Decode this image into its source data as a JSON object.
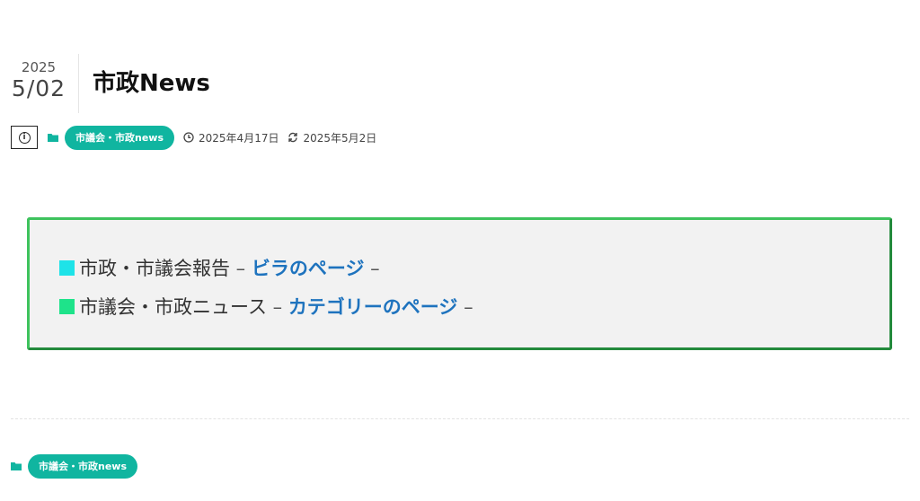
{
  "post": {
    "year": "2025",
    "month_day": "5/02",
    "title": "市政News",
    "category": "市議会・市政news",
    "published": "2025年4月17日",
    "updated": "2025年5月2日"
  },
  "icons": {
    "info": "info-icon",
    "folder": "folder-icon",
    "clock": "clock-icon",
    "refresh": "refresh-icon"
  },
  "notice": {
    "line1_prefix": "市政・市議会報告",
    "line1_sep": " – ",
    "line1_link": "ビラのページ",
    "line1_suffix": " –",
    "line2_prefix": "市議会・市政ニュース",
    "line2_sep": " – ",
    "line2_link": "カテゴリーのページ",
    "line2_suffix": " –"
  },
  "footer": {
    "category": "市議会・市政news"
  },
  "colors": {
    "accent_teal": "#10b5a0",
    "link_blue": "#1e73be",
    "box_border_green": "#2e9e4a",
    "square_cyan": "#1ee3e8",
    "square_green": "#1ee38a"
  }
}
